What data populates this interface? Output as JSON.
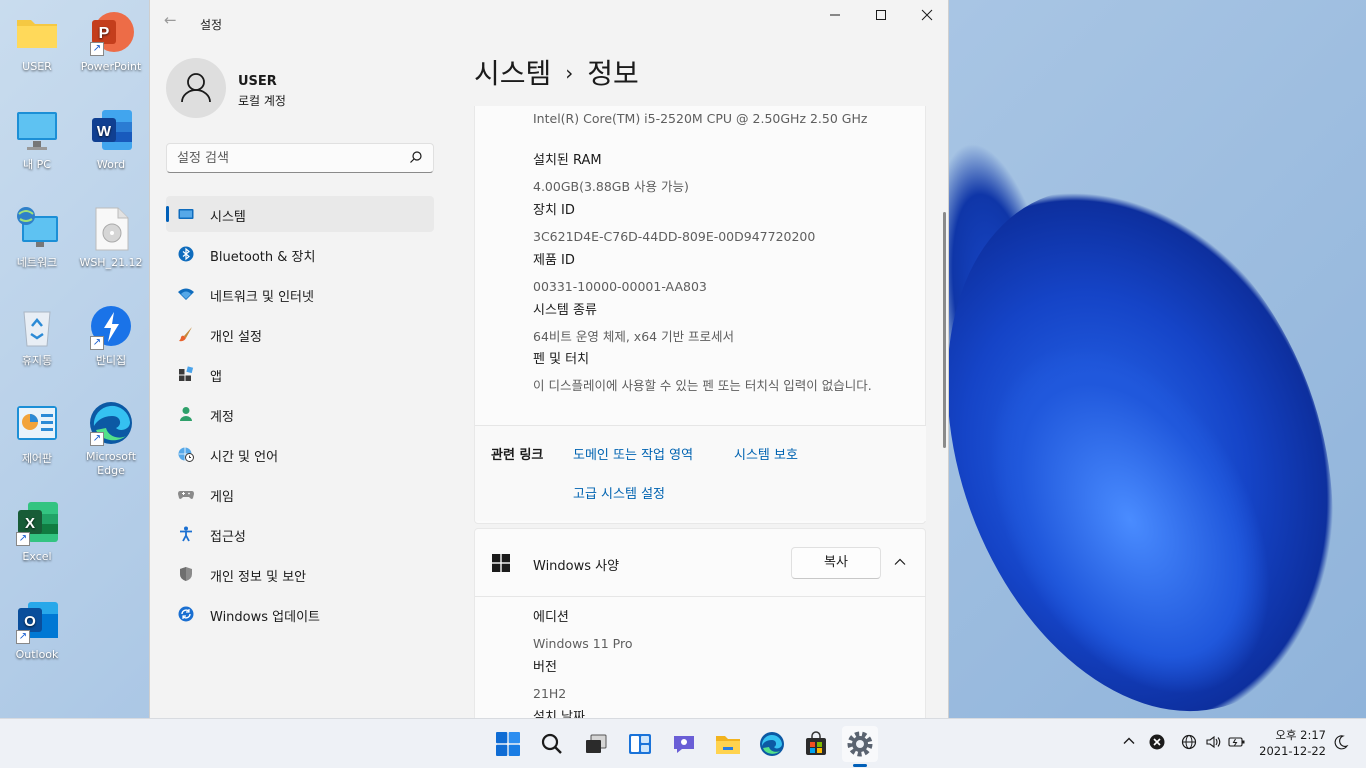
{
  "desktop": {
    "icons": [
      {
        "name": "USER",
        "kind": "folder-icon"
      },
      {
        "name": "PowerPoint",
        "kind": "powerpoint-icon"
      },
      {
        "name": "내 PC",
        "kind": "computer-icon"
      },
      {
        "name": "Word",
        "kind": "word-icon"
      },
      {
        "name": "네트워크",
        "kind": "network-icon"
      },
      {
        "name": "WSH_21.12",
        "kind": "file-icon"
      },
      {
        "name": "휴지통",
        "kind": "recycle-bin-icon"
      },
      {
        "name": "반디집",
        "kind": "bandizip-icon"
      },
      {
        "name": "제어판",
        "kind": "control-panel-icon"
      },
      {
        "name": "Microsoft Edge",
        "kind": "edge-icon"
      },
      {
        "name": "Excel",
        "kind": "excel-icon"
      },
      {
        "name": "Outlook",
        "kind": "outlook-icon"
      }
    ]
  },
  "window": {
    "title": "설정",
    "controls": {
      "minimize": "minimize-icon",
      "maximize": "maximize-icon",
      "close": "close-icon"
    }
  },
  "account": {
    "name": "USER",
    "type": "로컬 계정"
  },
  "search": {
    "placeholder": "설정 검색"
  },
  "nav": {
    "items": [
      {
        "label": "시스템",
        "icon": "monitor-icon",
        "active": true
      },
      {
        "label": "Bluetooth & 장치",
        "icon": "bluetooth-icon"
      },
      {
        "label": "네트워크 및 인터넷",
        "icon": "wifi-icon"
      },
      {
        "label": "개인 설정",
        "icon": "brush-icon"
      },
      {
        "label": "앱",
        "icon": "apps-icon"
      },
      {
        "label": "계정",
        "icon": "person-icon"
      },
      {
        "label": "시간 및 언어",
        "icon": "globe-clock-icon"
      },
      {
        "label": "게임",
        "icon": "gamepad-icon"
      },
      {
        "label": "접근성",
        "icon": "accessibility-icon"
      },
      {
        "label": "개인 정보 및 보안",
        "icon": "shield-icon"
      },
      {
        "label": "Windows 업데이트",
        "icon": "update-icon"
      }
    ]
  },
  "breadcrumb": {
    "parent": "시스템",
    "separator": "›",
    "current": "정보"
  },
  "device_specs": {
    "processor_value": "Intel(R) Core(TM) i5-2520M CPU @ 2.50GHz   2.50 GHz",
    "rows": [
      {
        "label": "설치된 RAM",
        "value": "4.00GB(3.88GB 사용 가능)"
      },
      {
        "label": "장치 ID",
        "value": "3C621D4E-C76D-44DD-809E-00D947720200"
      },
      {
        "label": "제품 ID",
        "value": "00331-10000-00001-AA803"
      },
      {
        "label": "시스템 종류",
        "value": "64비트 운영 체제, x64 기반 프로세서"
      },
      {
        "label": "펜 및 터치",
        "value": "이 디스플레이에 사용할 수 있는 펜 또는 터치식 입력이 없습니다."
      }
    ]
  },
  "related_links": {
    "title": "관련 링크",
    "links": [
      "도메인 또는 작업 영역",
      "시스템 보호",
      "고급 시스템 설정"
    ]
  },
  "windows_spec": {
    "title": "Windows 사양",
    "copy_label": "복사",
    "rows": [
      {
        "label": "에디션",
        "value": "Windows 11 Pro"
      },
      {
        "label": "버전",
        "value": "21H2"
      },
      {
        "label": "설치 날짜",
        "value": ""
      }
    ]
  },
  "taskbar": {
    "apps": [
      "start-icon",
      "search-icon",
      "task-view-icon",
      "widgets-icon",
      "chat-icon",
      "file-explorer-icon",
      "edge-icon",
      "store-icon",
      "settings-icon"
    ],
    "clock": {
      "time": "오후 2:17",
      "date": "2021-12-22"
    }
  },
  "colors": {
    "accent": "#005fb8",
    "link": "#0063b1"
  }
}
